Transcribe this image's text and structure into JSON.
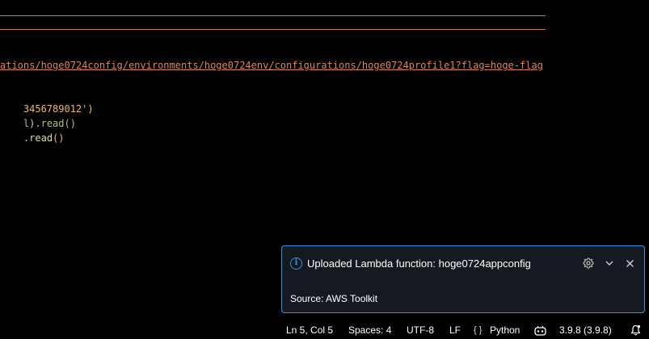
{
  "editor": {
    "url_line": "ations/hoge0724config/environments/hoge0724env/configurations/hoge0724profile1?flag=hoge-flag",
    "line2": {
      "string_part": "3456789012'",
      "close_paren": ")"
    },
    "line3": {
      "prefix": "l",
      "paren": ")",
      "rest": ".read()"
    },
    "line4": {
      "dot": ".",
      "fn": "read",
      "parens": "()"
    }
  },
  "notification": {
    "message": "Uploaded Lambda function: hoge0724appconfig",
    "source": "Source: AWS Toolkit",
    "border_color": "#3a8ee6",
    "icons": [
      "info-icon",
      "gear-icon",
      "chevron-down-icon",
      "close-icon"
    ]
  },
  "statusbar": {
    "position": "Ln 5, Col 5",
    "spaces": "Spaces: 4",
    "encoding": "UTF-8",
    "eol": "LF",
    "language_braces": "{ }",
    "language": "Python",
    "python_version": "3.9.8 (3.9.8)",
    "icons": [
      "copilot-icon",
      "bell-icon"
    ]
  }
}
